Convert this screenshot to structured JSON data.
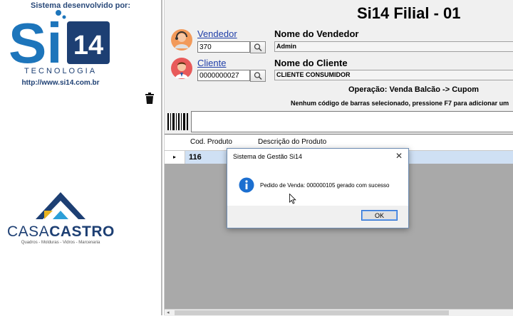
{
  "branding": {
    "developed_by": "Sistema desenvolvido por:",
    "logo_letters": "Si",
    "logo_number": "14",
    "tecnologia": "TECNOLOGIA",
    "url": "http://www.si14.com.br"
  },
  "client_logo": {
    "name_part1": "CASA",
    "name_part2": "CASTRO",
    "tagline": "Quadros - Molduras - Vidros - Marcenaria"
  },
  "header": {
    "title": "Si14 Filial - 01"
  },
  "vendor": {
    "label": "Vendedor",
    "code": "370",
    "name_label": "Nome do Vendedor",
    "name": "Admin"
  },
  "client": {
    "label": "Cliente",
    "code": "0000000027",
    "name_label": "Nome do Cliente",
    "name": "CLIENTE CONSUMIDOR"
  },
  "operation": "Operação: Venda Balcão -> Cupom",
  "barcode_hint": "Nenhum código de barras selecionado, pressione F7 para adicionar um",
  "grid": {
    "columns": [
      "Cod. Produto",
      "Descrição do Produto"
    ],
    "row_marker": "▸",
    "rows": [
      {
        "code": "116",
        "description": ""
      }
    ]
  },
  "dialog": {
    "title": "Sistema de Gestão Si14",
    "close": "✕",
    "message": "Pedido de Venda: 000000105 gerado com sucesso",
    "ok_label": "OK"
  },
  "scroll": {
    "left_arrow": "◂"
  },
  "colors": {
    "brand_blue": "#1d75bb",
    "brand_dark": "#1d3f73",
    "link": "#1f3ea8",
    "info_blue": "#1c6fd0",
    "selection_row": "#cfe0f4"
  }
}
